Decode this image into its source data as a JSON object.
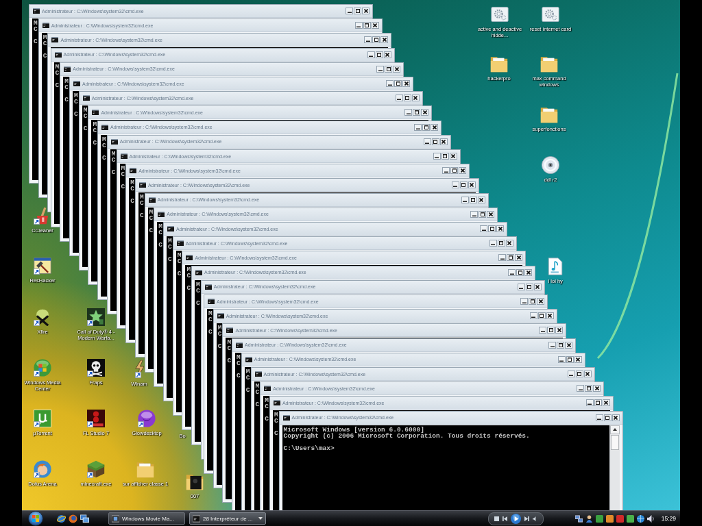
{
  "desktop_icons": [
    {
      "label": "active and deactive hidde...",
      "kind": "gear-document",
      "shortcut": false
    },
    {
      "label": "reset internet card",
      "kind": "gear-document",
      "shortcut": false
    },
    {
      "label": "hackerpro",
      "kind": "folder",
      "shortcut": false
    },
    {
      "label": "max command windows",
      "kind": "folder",
      "shortcut": false
    },
    {
      "label": "superfonctions",
      "kind": "folder",
      "shortcut": false
    },
    {
      "label": "ddl r2",
      "kind": "disc",
      "shortcut": false
    },
    {
      "label": "I lol hy",
      "kind": "music-file",
      "shortcut": false
    },
    {
      "label": "CCleaner",
      "kind": "broom",
      "shortcut": true
    },
    {
      "label": "ResHacker",
      "kind": "hammer",
      "shortcut": true
    },
    {
      "label": "Xfire",
      "kind": "x-figure",
      "shortcut": true
    },
    {
      "label": "Call of Duty® 4 - Modern Warfa...",
      "kind": "star-tile",
      "shortcut": true
    },
    {
      "label": "Windows Media Center",
      "kind": "flag-orb",
      "shortcut": true
    },
    {
      "label": "Fraps",
      "kind": "skull",
      "shortcut": true
    },
    {
      "label": "Winam",
      "kind": "lightning",
      "shortcut": true
    },
    {
      "label": "µTorrent",
      "kind": "logo-tile",
      "shortcut": true
    },
    {
      "label": "FL Studio 7",
      "kind": "circles-tile",
      "shortcut": true
    },
    {
      "label": "Glowdesktop",
      "kind": "sphere",
      "shortcut": true
    },
    {
      "label": "Bo",
      "kind": "covered"
    },
    {
      "label": "Dofus Arena",
      "kind": "cartoon-head",
      "shortcut": true
    },
    {
      "label": "minecraft.exe",
      "kind": "grass-block",
      "shortcut": true
    },
    {
      "label": "sur afficher classe 1",
      "kind": "folder",
      "shortcut": false
    },
    {
      "label": "007",
      "kind": "image-folder",
      "shortcut": false
    }
  ],
  "windows": [
    {
      "title": "Administrateur : C:\\Windows\\system32\\cmd.exe",
      "console": {
        "lines": [
          "M",
          "C"
        ],
        "prompt": "C"
      }
    },
    {
      "title": "Administrateur : C:\\Windows\\system32\\cmd.exe",
      "console": {
        "lines": [
          "M",
          "C"
        ],
        "prompt": "C"
      }
    },
    {
      "title": "Administrateur : C:\\Windows\\system32\\cmd.exe"
    },
    {
      "title": "Administrateur : C:\\Windows\\system32\\cmd.exe",
      "console": {
        "lines": [
          "M",
          "C"
        ],
        "prompt": "C"
      }
    },
    {
      "title": "Administrateur : C:\\Windows\\system32\\cmd.exe",
      "console": {
        "lines": [
          "M",
          "C"
        ],
        "prompt": "C"
      }
    },
    {
      "title": "Administrateur : C:\\Windows\\system32\\cmd.exe",
      "console": {
        "lines": [
          "M",
          "C"
        ],
        "prompt": "C"
      }
    },
    {
      "title": "Administrateur : C:\\Windows\\system32\\cmd.exe",
      "console": {
        "lines": [
          "M",
          "C"
        ],
        "prompt": "C"
      }
    },
    {
      "title": "Administrateur : C:\\Windows\\system32\\cmd.exe",
      "console": {
        "lines": [
          "M",
          "C"
        ],
        "prompt": "C"
      }
    },
    {
      "title": "Administrateur : C:\\Windows\\system32\\cmd.exe",
      "console": {
        "lines": [
          "M",
          "C"
        ],
        "prompt": "C"
      }
    },
    {
      "title": "Administrateur : C:\\Windows\\system32\\cmd.exe",
      "console": {
        "lines": [
          "M",
          "C"
        ],
        "prompt": "C"
      }
    },
    {
      "title": "Administrateur : C:\\Windows\\system32\\cmd.exe",
      "console": {
        "lines": [
          "M",
          "C"
        ],
        "prompt": "C"
      }
    },
    {
      "title": "Administrateur : C:\\Windows\\system32\\cmd.exe",
      "console": {
        "lines": [
          "M",
          "C"
        ],
        "prompt": "C"
      }
    },
    {
      "title": "Administrateur : C:\\Windows\\system32\\cmd.exe",
      "console": {
        "lines": [
          "M",
          "C"
        ],
        "prompt": "C"
      }
    },
    {
      "title": "Administrateur : C:\\Windows\\system32\\cmd.exe",
      "console": {
        "lines": [
          "M",
          "C"
        ],
        "prompt": "C"
      }
    },
    {
      "title": "Administrateur : C:\\Windows\\system32\\cmd.exe",
      "console": {
        "lines": [
          "M",
          "C"
        ],
        "prompt": "C"
      }
    },
    {
      "title": "Administrateur : C:\\Windows\\system32\\cmd.exe",
      "console": {
        "lines": [
          "M",
          "C"
        ],
        "prompt": "C"
      }
    },
    {
      "title": "Administrateur : C:\\Windows\\system32\\cmd.exe",
      "console": {
        "lines": [
          "M",
          "C"
        ],
        "prompt": "C"
      }
    },
    {
      "title": "Administrateur : C:\\Windows\\system32\\cmd.exe",
      "console": {
        "lines": [
          "M",
          "C"
        ],
        "prompt": "C"
      }
    },
    {
      "title": "Administrateur : C:\\Windows\\system32\\cmd.exe",
      "console": {
        "lines": [
          "M",
          "C"
        ],
        "prompt": "C"
      }
    },
    {
      "title": "Administrateur : C:\\Windows\\system32\\cmd.exe"
    },
    {
      "title": "Administrateur : C:\\Windows\\system32\\cmd.exe",
      "console": {
        "lines": [
          "M",
          "C"
        ],
        "prompt": "C"
      }
    },
    {
      "title": "Administrateur : C:\\Windows\\system32\\cmd.exe",
      "console": {
        "lines": [
          "M",
          "C"
        ],
        "prompt": "C"
      }
    },
    {
      "title": "Administrateur : C:\\Windows\\system32\\cmd.exe",
      "console": {
        "lines": [
          "M",
          "C"
        ],
        "prompt": "C"
      }
    },
    {
      "title": "Administrateur : C:\\Windows\\system32\\cmd.exe",
      "console": {
        "lines": [
          "M",
          "C"
        ],
        "prompt": "C"
      }
    },
    {
      "title": "Administrateur : C:\\Windows\\system32\\cmd.exe",
      "console": {
        "lines": [
          "M",
          "C"
        ],
        "prompt": "C"
      }
    },
    {
      "title": "Administrateur : C:\\Windows\\system32\\cmd.exe",
      "console": {
        "lines": [
          "M",
          "C"
        ],
        "prompt": "C"
      }
    },
    {
      "title": "Administrateur : C:\\Windows\\system32\\cmd.exe",
      "console": {
        "lines": [
          "M",
          "C"
        ],
        "prompt": "C"
      }
    },
    {
      "title": "Administrateur : C:\\Windows\\system32\\cmd.exe",
      "console": {
        "lines": [
          "M",
          "C"
        ],
        "prompt": "C"
      }
    },
    {
      "title": "Administrateur : C:\\Windows\\system32\\cmd.exe",
      "console": {
        "lines": [
          "Microsoft Windows [version 6.0.6000]",
          "Copyright (c) 2006 Microsoft Corporation. Tous droits réservés."
        ],
        "prompt": "C:\\Users\\max>"
      }
    }
  ],
  "taskbar": {
    "tasks": [
      {
        "label": "Windows Movie Ma...",
        "kind": "film",
        "grouped": false
      },
      {
        "label": "28 Interpréteur de ...",
        "kind": "console",
        "grouped": true
      }
    ],
    "clock": "15:29"
  }
}
